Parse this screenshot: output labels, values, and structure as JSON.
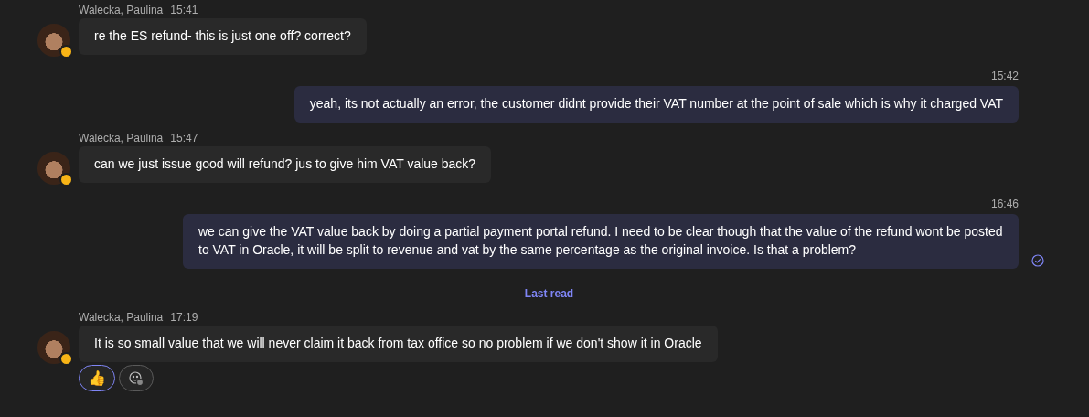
{
  "messages": [
    {
      "kind": "received",
      "author": "Walecka, Paulina",
      "time": "15:41",
      "text": "re the ES refund- this is just one off? correct?",
      "away": true
    },
    {
      "kind": "sent",
      "time": "15:42",
      "text": "yeah, its not actually an error, the customer didnt provide their VAT number at the point of sale which is why it charged VAT",
      "seen": false
    },
    {
      "kind": "received",
      "author": "Walecka, Paulina",
      "time": "15:47",
      "text": "can we just issue good will refund? jus to give him VAT value back?",
      "away": true
    },
    {
      "kind": "sent",
      "time": "16:46",
      "text": "we can give the VAT value back by doing a partial payment portal refund. I need to be clear though that the value of the refund wont be posted to VAT in Oracle, it will be split to revenue and vat by the same percentage as the original invoice. Is that a problem?",
      "seen": true
    },
    {
      "kind": "divider",
      "label": "Last read"
    },
    {
      "kind": "received",
      "author": "Walecka, Paulina",
      "time": "17:19",
      "text": "It is so small value that we will never claim it back from tax office so no problem if we don't show it in Oracle",
      "away": true,
      "reactions": [
        {
          "emoji": "👍",
          "selected": true
        }
      ]
    }
  ]
}
